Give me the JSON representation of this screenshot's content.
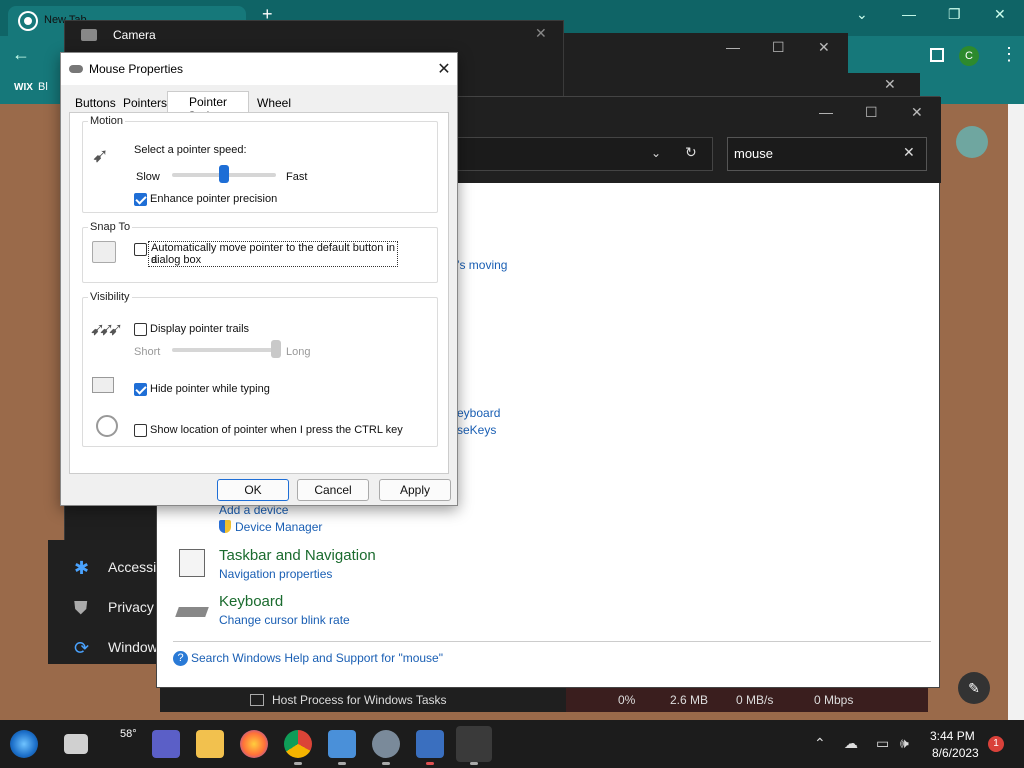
{
  "chrome": {
    "tab_title": "New Tab",
    "bookmark_label": "Bl"
  },
  "camera_window": {
    "title": "Camera"
  },
  "settings_left": {
    "items": [
      "Accessi",
      "Privacy",
      "Window"
    ]
  },
  "control_panel": {
    "search_value": "mouse",
    "partial_links": [
      "’s moving",
      "eyboard",
      "seKeys"
    ],
    "add_device": "Add a device",
    "device_manager": "Device Manager",
    "taskbar_heading": "Taskbar and Navigation",
    "taskbar_link": "Navigation properties",
    "keyboard_heading": "Keyboard",
    "keyboard_link": "Change cursor blink rate",
    "help_link": "Search Windows Help and Support for \"mouse\""
  },
  "task_manager": {
    "process": "Host Process for Windows Tasks",
    "cpu": "0%",
    "memory": "2.6 MB",
    "disk": "0 MB/s",
    "network": "0 Mbps"
  },
  "mouse_properties": {
    "title": "Mouse Properties",
    "tabs": [
      "Buttons",
      "Pointers",
      "Pointer Options",
      "Wheel"
    ],
    "active_tab": 2,
    "motion": {
      "legend": "Motion",
      "speed_label": "Select a pointer speed:",
      "slow": "Slow",
      "fast": "Fast",
      "speed_fraction": 0.5,
      "enhance_label": "Enhance pointer precision",
      "enhance_checked": true
    },
    "snap_to": {
      "legend": "Snap To",
      "auto_label_line1": "Automatically move pointer to the default button in a",
      "auto_label_line2": "dialog box",
      "auto_checked": false
    },
    "visibility": {
      "legend": "Visibility",
      "trails_label": "Display pointer trails",
      "trails_checked": false,
      "short": "Short",
      "long": "Long",
      "trail_fraction": 1.0,
      "hide_label": "Hide pointer while typing",
      "hide_checked": true,
      "ctrl_label": "Show location of pointer when I press the CTRL key",
      "ctrl_checked": false
    },
    "buttons": {
      "ok": "OK",
      "cancel": "Cancel",
      "apply": "Apply"
    }
  },
  "taskbar": {
    "weather_temp": "58°",
    "time": "3:44 PM",
    "date": "8/6/2023",
    "notification_count": "1"
  },
  "colors": {
    "accent": "#1e6ed6",
    "chrome_teal": "#0f6466",
    "link": "#1a5fb4",
    "heading_green": "#1a6b2e"
  }
}
